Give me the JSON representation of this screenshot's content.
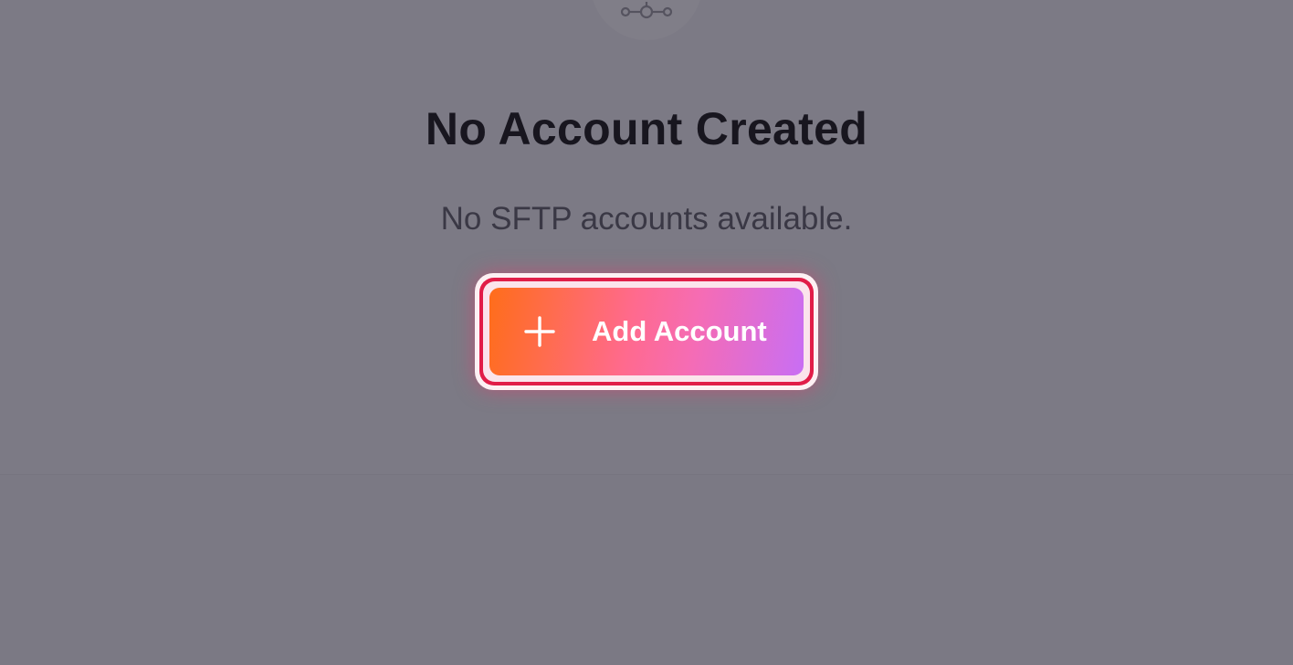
{
  "empty_state": {
    "icon": "network-icon",
    "title": "No Account Created",
    "message": "No SFTP accounts available."
  },
  "actions": {
    "add_account": {
      "label": "Add Account",
      "icon": "plus-icon"
    }
  },
  "colors": {
    "overlay_background": "#7c7a85",
    "title_text": "#18161f",
    "message_text": "#3a3845",
    "button_gradient_start": "#ff6d1a",
    "button_gradient_mid": "#ff6a8e",
    "button_gradient_end": "#c86ef4",
    "focus_ring": "#e11d48"
  }
}
